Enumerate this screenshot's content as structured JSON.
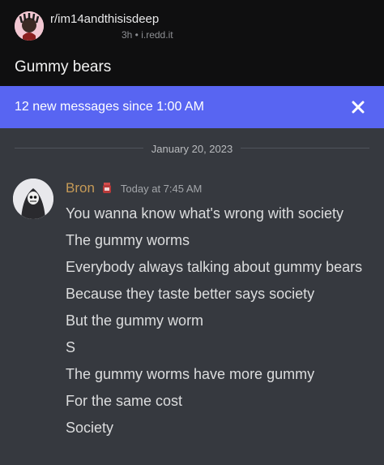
{
  "reddit": {
    "subreddit": "r/im14andthisisdeep",
    "meta": "3h • i.redd.it",
    "post_title": "Gummy bears"
  },
  "banner": {
    "text": "12 new messages since 1:00 AM",
    "close_icon": "close-icon"
  },
  "divider": {
    "date": "January 20, 2023"
  },
  "message": {
    "author": "Bron",
    "author_color": "#c59a57",
    "timestamp": "Today at 7:45 AM",
    "lines": [
      "You wanna know what's wrong with society",
      "The gummy worms",
      "Everybody always talking about gummy bears",
      "Because they taste better says society",
      "But the gummy worm",
      "S",
      "The gummy worms have more gummy",
      "For the same cost",
      "Society"
    ]
  },
  "colors": {
    "banner": "#5865f2",
    "background": "#36393f",
    "header": "#0f0f10"
  }
}
